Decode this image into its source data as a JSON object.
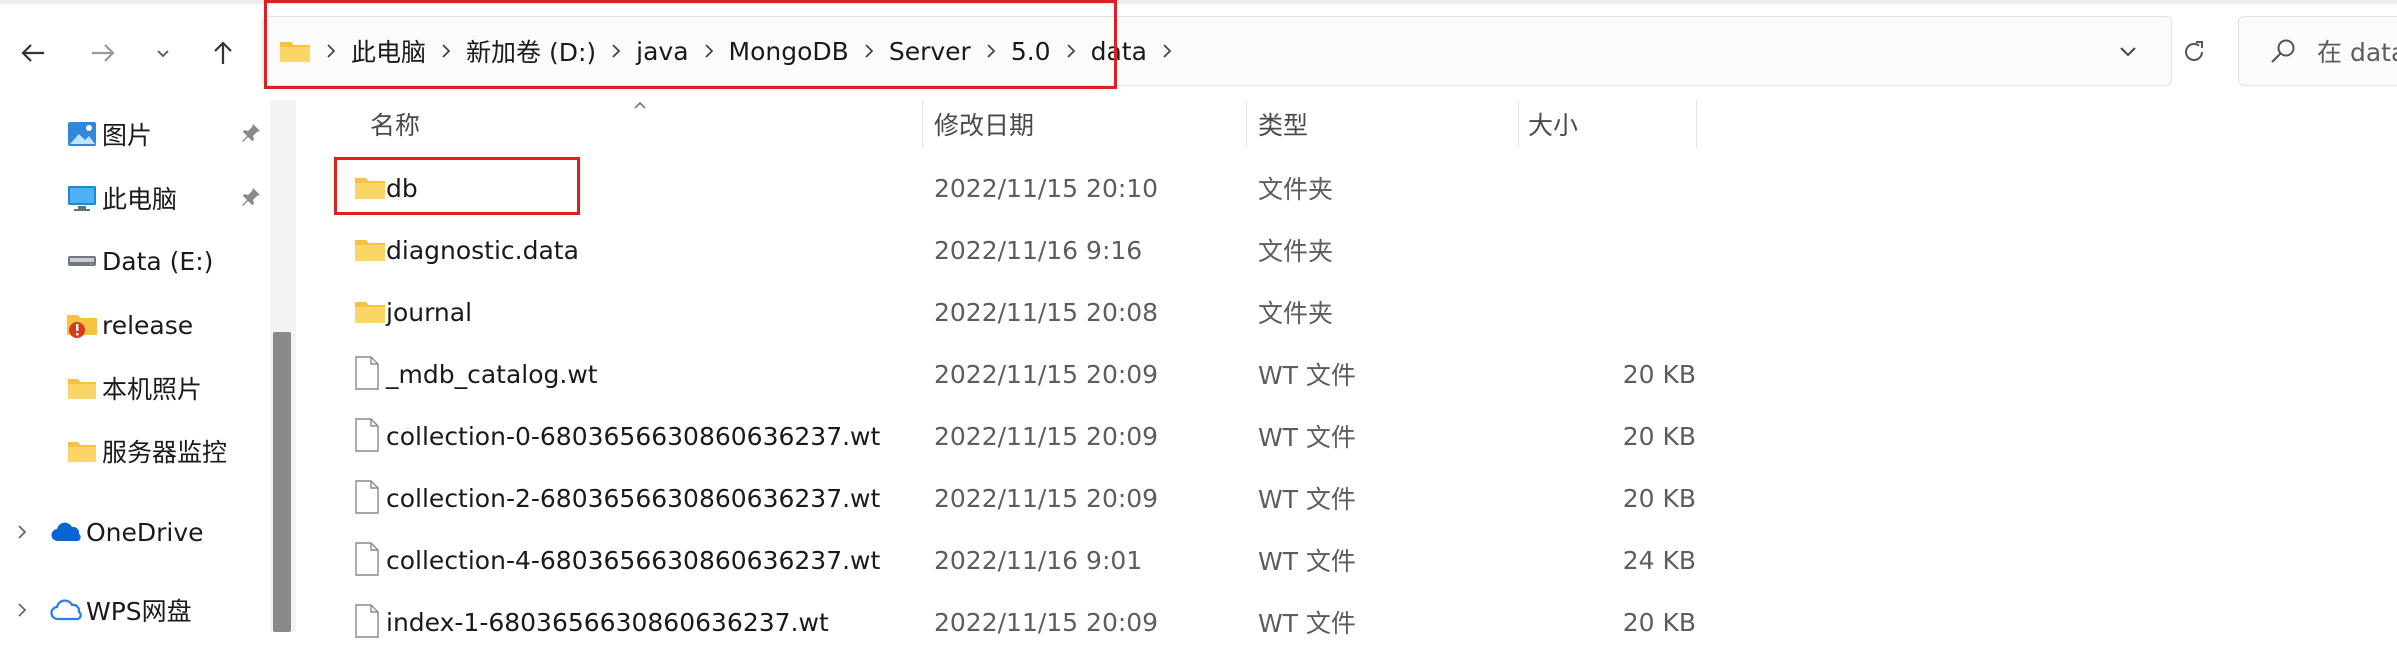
{
  "nav": {
    "back_icon": "arrow-left-icon",
    "forward_icon": "arrow-right-icon",
    "recent_icon": "chevron-down-icon",
    "up_icon": "arrow-up-icon"
  },
  "address_bar": {
    "folder_icon": "folder-icon",
    "crumbs": [
      "此电脑",
      "新加卷 (D:)",
      "java",
      "MongoDB",
      "Server",
      "5.0",
      "data"
    ],
    "dropdown_icon": "chevron-down-icon",
    "refresh_icon": "refresh-icon"
  },
  "search": {
    "placeholder": "在 data"
  },
  "sidebar": {
    "items": [
      {
        "label": "图片",
        "icon": "pictures-icon",
        "pinned": true
      },
      {
        "label": "此电脑",
        "icon": "this-pc-icon",
        "pinned": true
      },
      {
        "label": "Data (E:)",
        "icon": "drive-icon",
        "pinned": false
      },
      {
        "label": "release",
        "icon": "folder-warning-icon",
        "pinned": false
      },
      {
        "label": "本机照片",
        "icon": "folder-icon",
        "pinned": false
      },
      {
        "label": "服务器监控",
        "icon": "folder-icon",
        "pinned": false
      },
      {
        "label": "OneDrive",
        "icon": "onedrive-cloud-icon",
        "pinned": false
      },
      {
        "label": "WPS网盘",
        "icon": "wps-cloud-icon",
        "pinned": false
      }
    ]
  },
  "columns": {
    "name": "名称",
    "date": "修改日期",
    "type": "类型",
    "size": "大小"
  },
  "files": [
    {
      "name": "db",
      "date": "2022/11/15 20:10",
      "type": "文件夹",
      "size": "",
      "icon": "folder-icon"
    },
    {
      "name": "diagnostic.data",
      "date": "2022/11/16 9:16",
      "type": "文件夹",
      "size": "",
      "icon": "folder-icon"
    },
    {
      "name": "journal",
      "date": "2022/11/15 20:08",
      "type": "文件夹",
      "size": "",
      "icon": "folder-icon"
    },
    {
      "name": "_mdb_catalog.wt",
      "date": "2022/11/15 20:09",
      "type": "WT 文件",
      "size": "20 KB",
      "icon": "file-icon"
    },
    {
      "name": "collection-0-6803656630860636237.wt",
      "date": "2022/11/15 20:09",
      "type": "WT 文件",
      "size": "20 KB",
      "icon": "file-icon"
    },
    {
      "name": "collection-2-6803656630860636237.wt",
      "date": "2022/11/15 20:09",
      "type": "WT 文件",
      "size": "20 KB",
      "icon": "file-icon"
    },
    {
      "name": "collection-4-6803656630860636237.wt",
      "date": "2022/11/16 9:01",
      "type": "WT 文件",
      "size": "24 KB",
      "icon": "file-icon"
    },
    {
      "name": "index-1-6803656630860636237.wt",
      "date": "2022/11/15 20:09",
      "type": "WT 文件",
      "size": "20 KB",
      "icon": "file-icon"
    }
  ],
  "colors": {
    "highlight": "#e02020",
    "folder": "#f5c242",
    "accent": "#0078d4"
  }
}
